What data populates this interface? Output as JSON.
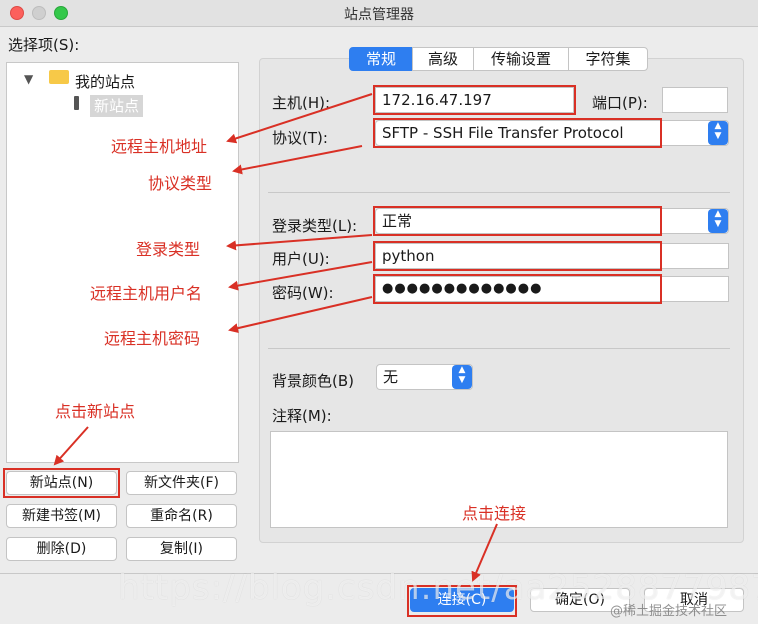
{
  "window": {
    "title": "站点管理器"
  },
  "left": {
    "select_label": "选择项(S):",
    "tree": {
      "root_label": "我的站点",
      "child_label": "新站点"
    },
    "buttons": {
      "new_site": "新站点(N)",
      "new_folder": "新文件夹(F)",
      "new_bookmark": "新建书签(M)",
      "rename": "重命名(R)",
      "delete": "删除(D)",
      "copy": "复制(I)"
    }
  },
  "tabs": [
    "常规",
    "高级",
    "传输设置",
    "字符集"
  ],
  "form": {
    "host_label": "主机(H):",
    "host_value": "172.16.47.197",
    "port_label": "端口(P):",
    "port_value": "",
    "protocol_label": "协议(T):",
    "protocol_value": "SFTP - SSH File Transfer Protocol",
    "login_type_label": "登录类型(L):",
    "login_type_value": "正常",
    "user_label": "用户(U):",
    "user_value": "python",
    "password_label": "密码(W):",
    "password_value": "●●●●●●●●●●●●●",
    "bg_color_label": "背景颜色(B)",
    "bg_color_value": "无",
    "comment_label": "注释(M):",
    "comment_value": ""
  },
  "bottom": {
    "connect": "连接(C)",
    "ok": "确定(O)",
    "cancel": "取消"
  },
  "annotations": {
    "remote_host": "远程主机地址",
    "protocol_type": "协议类型",
    "login_type": "登录类型",
    "remote_user": "远程主机用户名",
    "remote_password": "远程主机密码",
    "click_new_site": "点击新站点",
    "click_connect": "点击连接"
  },
  "watermark": {
    "url": "https://blog.csdn.net/aa2528877987",
    "credit": "@稀土掘金技术社区"
  },
  "colors": {
    "accent": "#2e7ef0",
    "annotation": "#d93025",
    "panel": "#e6e6e6"
  }
}
